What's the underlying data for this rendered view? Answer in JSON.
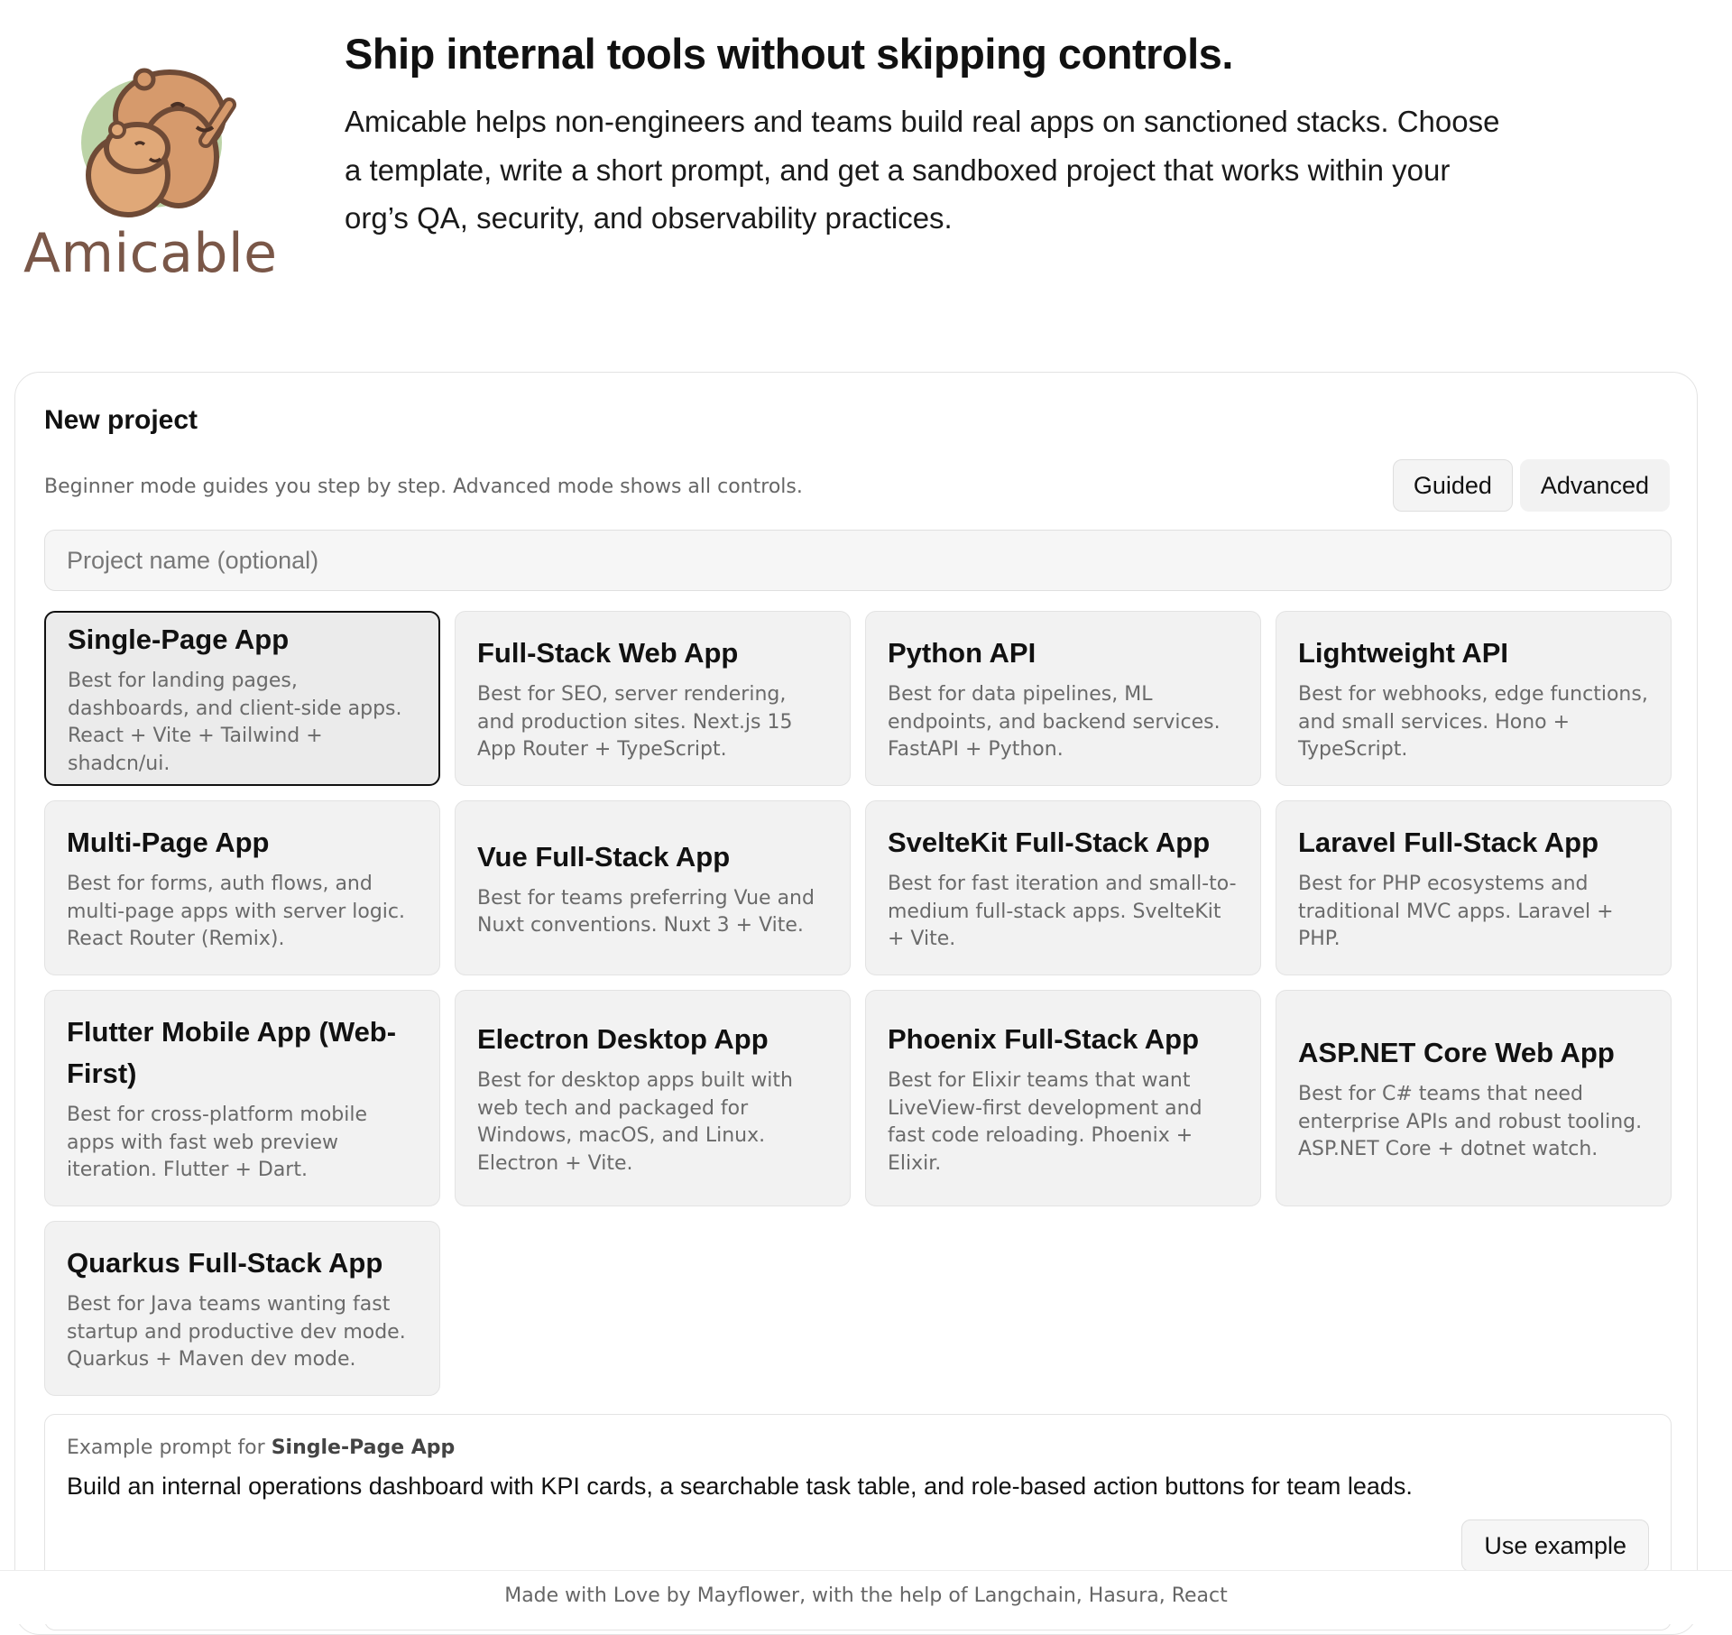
{
  "brand": {
    "name": "Amicable",
    "logo_icon": "capybara-logo-icon"
  },
  "hero": {
    "title": "Ship internal tools without skipping controls.",
    "description": "Amicable helps non-engineers and teams build real apps on sanctioned stacks. Choose a template, write a short prompt, and get a sandboxed project that works within your org’s QA, security, and observability practices."
  },
  "new_project": {
    "title": "New project",
    "mode_help": "Beginner mode guides you step by step. Advanced mode shows all controls.",
    "modes": [
      {
        "label": "Guided",
        "active": true
      },
      {
        "label": "Advanced",
        "active": false
      }
    ],
    "name_placeholder": "Project name (optional)",
    "name_value": "",
    "templates": [
      {
        "title": "Single-Page App",
        "description": "Best for landing pages, dashboards, and client-side apps. React + Vite + Tailwind + shadcn/ui.",
        "selected": true
      },
      {
        "title": "Full-Stack Web App",
        "description": "Best for SEO, server rendering, and production sites. Next.js 15 App Router + TypeScript.",
        "selected": false
      },
      {
        "title": "Python API",
        "description": "Best for data pipelines, ML endpoints, and backend services. FastAPI + Python.",
        "selected": false
      },
      {
        "title": "Lightweight API",
        "description": "Best for webhooks, edge functions, and small services. Hono + TypeScript.",
        "selected": false
      },
      {
        "title": "Multi-Page App",
        "description": "Best for forms, auth flows, and multi-page apps with server logic. React Router (Remix).",
        "selected": false
      },
      {
        "title": "Vue Full-Stack App",
        "description": "Best for teams preferring Vue and Nuxt conventions. Nuxt 3 + Vite.",
        "selected": false
      },
      {
        "title": "SvelteKit Full-Stack App",
        "description": "Best for fast iteration and small-to-medium full-stack apps. SvelteKit + Vite.",
        "selected": false
      },
      {
        "title": "Laravel Full-Stack App",
        "description": "Best for PHP ecosystems and traditional MVC apps. Laravel + PHP.",
        "selected": false
      },
      {
        "title": "Flutter Mobile App (Web-First)",
        "description": "Best for cross-platform mobile apps with fast web preview iteration. Flutter + Dart.",
        "selected": false
      },
      {
        "title": "Electron Desktop App",
        "description": "Best for desktop apps built with web tech and packaged for Windows, macOS, and Linux. Electron + Vite.",
        "selected": false
      },
      {
        "title": "Phoenix Full-Stack App",
        "description": "Best for Elixir teams that want LiveView-first development and fast code reloading. Phoenix + Elixir.",
        "selected": false
      },
      {
        "title": "ASP.NET Core Web App",
        "description": "Best for C# teams that need enterprise APIs and robust tooling. ASP.NET Core + dotnet watch.",
        "selected": false
      },
      {
        "title": "Quarkus Full-Stack App",
        "description": "Best for Java teams wanting fast startup and productive dev mode. Quarkus + Maven dev mode.",
        "selected": false
      }
    ],
    "example": {
      "label_prefix": "Example prompt for ",
      "template_name": "Single-Page App",
      "prompt": "Build an internal operations dashboard with KPI cards, a searchable task table, and role-based action buttons for team leads.",
      "use_button": "Use example"
    }
  },
  "footer": {
    "text": "Made with Love by Mayflower, with the help of Langchain, Hasura, React"
  }
}
